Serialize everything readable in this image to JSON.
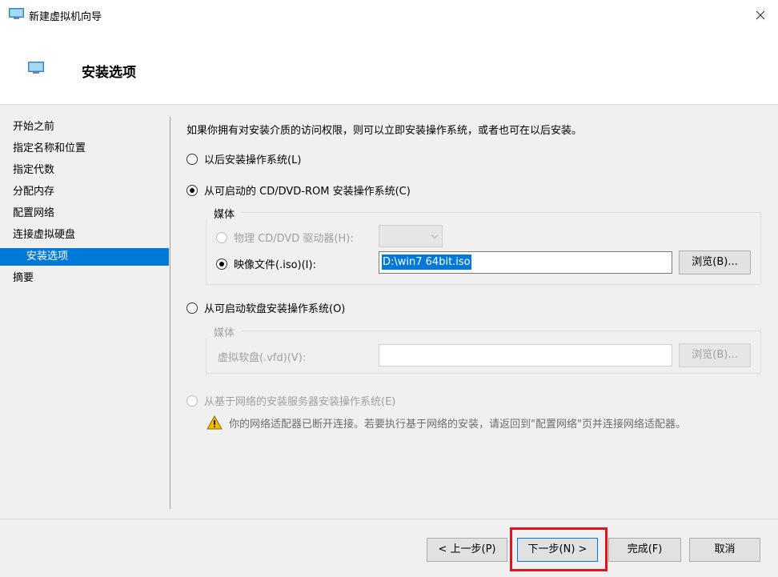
{
  "window": {
    "title": "新建虚拟机向导",
    "close_glyph": "✕"
  },
  "header": {
    "title": "安装选项"
  },
  "sidebar": {
    "items": [
      {
        "label": "开始之前",
        "selected": false
      },
      {
        "label": "指定名称和位置",
        "selected": false
      },
      {
        "label": "指定代数",
        "selected": false
      },
      {
        "label": "分配内存",
        "selected": false
      },
      {
        "label": "配置网络",
        "selected": false
      },
      {
        "label": "连接虚拟硬盘",
        "selected": false
      },
      {
        "label": "安装选项",
        "selected": true
      },
      {
        "label": "摘要",
        "selected": false
      }
    ]
  },
  "content": {
    "intro": "如果你拥有对安装介质的访问权限，则可以立即安装操作系统，或者也可在以后安装。",
    "option_later": "以后安装操作系统(L)",
    "option_cd": "从可启动的 CD/DVD-ROM 安装操作系统(C)",
    "cd_group_label": "媒体",
    "cd_physical": "物理 CD/DVD 驱动器(H):",
    "cd_image": "映像文件(.iso)(I):",
    "cd_image_value": "D:\\win7 64bit.iso",
    "cd_browse": "浏览(B)...",
    "option_floppy": "从可启动软盘安装操作系统(O)",
    "floppy_group_label": "媒体",
    "floppy_label": "虚拟软盘(.vfd)(V):",
    "floppy_value": "",
    "floppy_browse": "浏览(B)...",
    "option_network": "从基于网络的安装服务器安装操作系统(E)",
    "warning": "你的网络适配器已断开连接。若要执行基于网络的安装，请返回到\"配置网络\"页并连接网络适配器。",
    "selected_option": "cd"
  },
  "footer": {
    "prev": "< 上一步(P)",
    "next": "下一步(N) >",
    "finish": "完成(F)",
    "cancel": "取消"
  },
  "colors": {
    "accent": "#0078d7",
    "highlight": "#e0141e",
    "panel": "#f0f0f0"
  }
}
